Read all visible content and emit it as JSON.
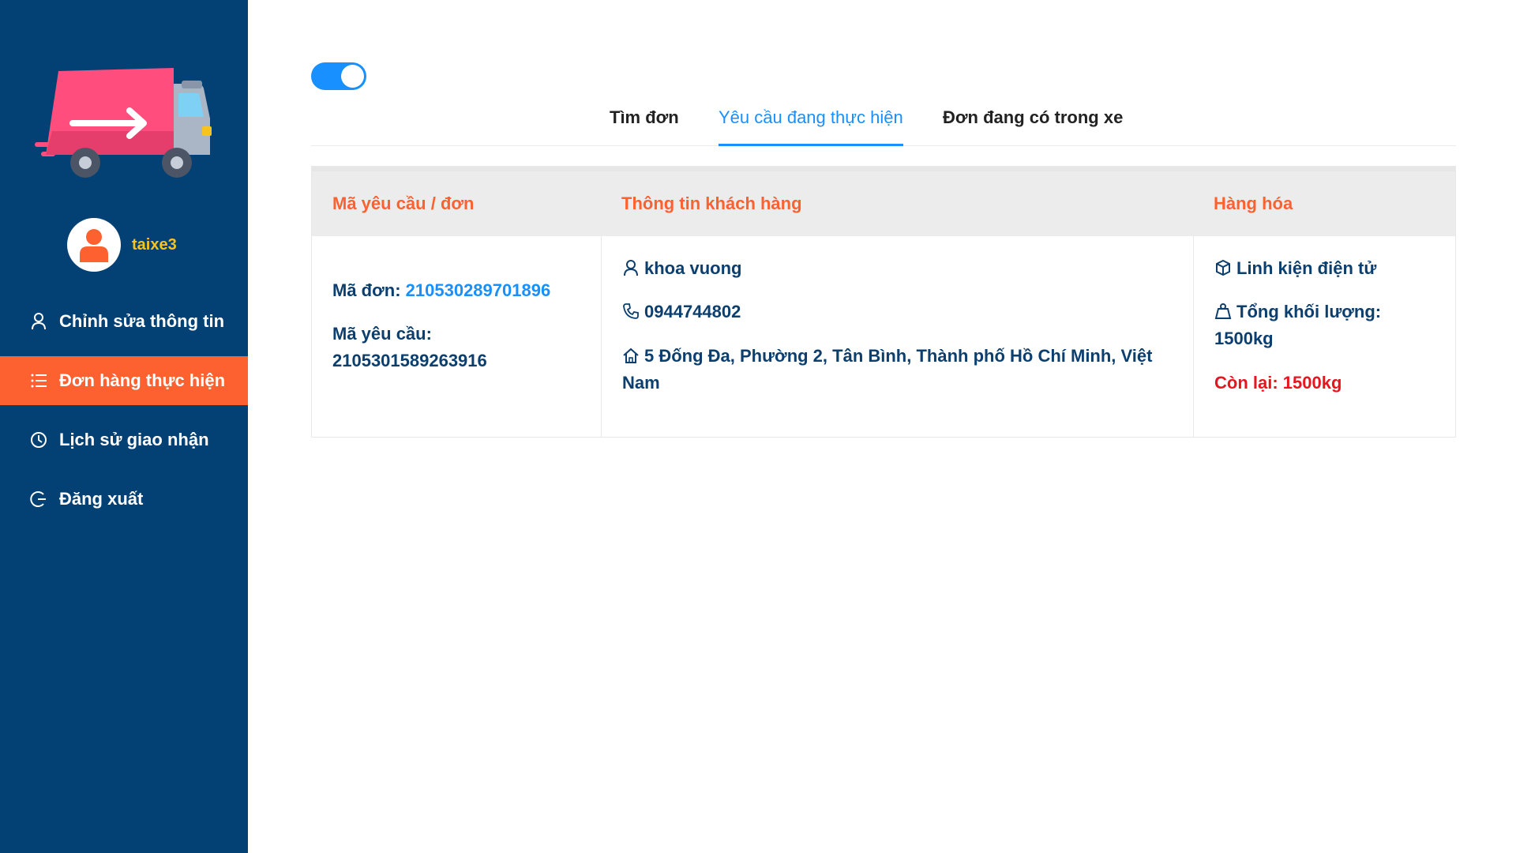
{
  "user": {
    "username": "taixe3"
  },
  "nav": {
    "items": [
      {
        "label": "Chỉnh sửa thông tin",
        "icon": "user-icon"
      },
      {
        "label": "Đơn hàng thực hiện",
        "icon": "list-icon",
        "active": true
      },
      {
        "label": "Lịch sử giao nhận",
        "icon": "clock-icon"
      },
      {
        "label": "Đăng xuất",
        "icon": "logout-icon"
      }
    ]
  },
  "toggle": {
    "on": true
  },
  "tabs": [
    {
      "label": "Tìm đơn"
    },
    {
      "label": "Yêu cầu đang thực hiện",
      "active": true
    },
    {
      "label": "Đơn đang có trong xe"
    }
  ],
  "table": {
    "headers": [
      "Mã yêu cầu / đơn",
      "Thông tin khách hàng",
      "Hàng hóa"
    ],
    "row": {
      "order_label": "Mã đơn:",
      "order_id": "210530289701896",
      "request_label": "Mã yêu cầu:",
      "request_id": "2105301589263916",
      "customer_name": "khoa vuong",
      "customer_phone": "0944744802",
      "customer_address": "5 Đống Đa, Phường 2, Tân Bình, Thành phố Hồ Chí Minh, Việt Nam",
      "goods_name": "Linh kiện điện tử",
      "total_weight_label": "Tổng khối lượng:",
      "total_weight": "1500kg",
      "remaining": "Còn lại: 1500kg"
    }
  },
  "colors": {
    "sidebar": "#034175",
    "accent_orange": "#fd6130",
    "accent_blue": "#1890ff",
    "username": "#f7c31e",
    "text_navy": "#0c3f6e",
    "alert_red": "#e8141e"
  }
}
